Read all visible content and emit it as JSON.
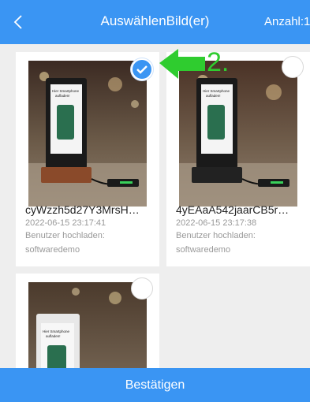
{
  "header": {
    "title": "AuswählenBild(er)",
    "count_label": "Anzahl:1"
  },
  "images": [
    {
      "name": "cyWzzh5d27Y3MrsH…",
      "date": "2022-06-15 23:17:41",
      "uploader_label": "Benutzer hochladen:",
      "uploader": "softwaredemo",
      "selected": true
    },
    {
      "name": "4yEAaA542jaarCB5r…",
      "date": "2022-06-15 23:17:38",
      "uploader_label": "Benutzer hochladen:",
      "uploader": "softwaredemo",
      "selected": false
    },
    {
      "selected": false
    }
  ],
  "thumb_text": {
    "line1": "Hier Smartphone",
    "line2": "aufladen!"
  },
  "annotation": {
    "label": "2.",
    "color": "#2fcc2f"
  },
  "footer": {
    "confirm_label": "Bestätigen"
  },
  "colors": {
    "accent": "#3a95f3"
  },
  "icons": {
    "back": "chevron-left-icon",
    "check": "checkmark-icon"
  }
}
